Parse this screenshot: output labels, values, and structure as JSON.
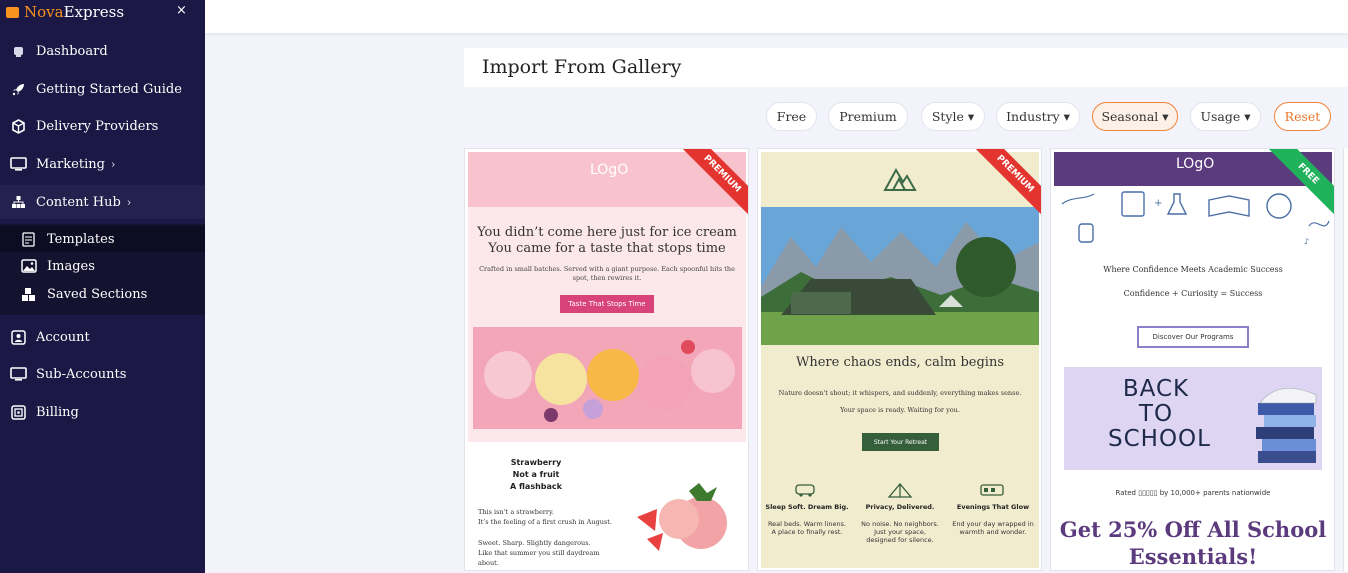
{
  "brand": {
    "part1": "Nova",
    "part2": "Express"
  },
  "sidebar": {
    "close": "×",
    "items": [
      {
        "label": "Dashboard",
        "icon": "dashboard-icon"
      },
      {
        "label": "Getting Started Guide",
        "icon": "rocket-icon"
      },
      {
        "label": "Delivery Providers",
        "icon": "box-icon"
      },
      {
        "label": "Marketing",
        "icon": "monitor-icon",
        "chevron": "›"
      },
      {
        "label": "Content Hub",
        "icon": "hierarchy-icon",
        "chevron": "›"
      }
    ],
    "sub_items": [
      {
        "label": "Templates",
        "icon": "template-icon"
      },
      {
        "label": "Images",
        "icon": "image-icon"
      },
      {
        "label": "Saved Sections",
        "icon": "blocks-icon"
      }
    ],
    "bottom_items": [
      {
        "label": "Account",
        "icon": "account-icon"
      },
      {
        "label": "Sub-Accounts",
        "icon": "monitor-icon"
      },
      {
        "label": "Billing",
        "icon": "billing-icon"
      }
    ]
  },
  "page": {
    "title": "Import From Gallery"
  },
  "filters": {
    "free": "Free",
    "premium": "Premium",
    "style": "Style ▾",
    "industry": "Industry ▾",
    "seasonal": "Seasonal ▾",
    "usage": "Usage ▾",
    "reset": "Reset"
  },
  "colors": {
    "sidebar": "#1b1845",
    "accent": "#f0833a",
    "premium": "#e3342f",
    "free": "#1fb25a"
  },
  "cards": [
    {
      "ribbon": "PREMIUM",
      "logo": "LOgO",
      "headline1": "You didn’t come here just for ice cream",
      "headline2": "You came for a taste that stops time",
      "body": "Crafted in small batches. Served with a giant purpose. Each spoonful hits the spot, then rewires it.",
      "cta": "Taste That Stops Time",
      "side_title": [
        "Strawberry",
        "Not a fruit",
        "A flashback"
      ],
      "para1": [
        "This isn’t a strawberry.",
        "It’s the feeling of a first crush in August."
      ],
      "para2": [
        "Sweet. Sharp. Slightly dangerous.",
        "Like that summer you still daydream",
        "about."
      ]
    },
    {
      "ribbon": "PREMIUM",
      "headline": "Where chaos ends, calm begins",
      "body1": "Nature doesn't shout; it whispers, and suddenly, everything makes sense.",
      "body2": "Your space is ready. Waiting for you.",
      "cta": "Start Your Retreat",
      "features": [
        {
          "title": "Sleep Soft. Dream Big.",
          "text": [
            "Real beds. Warm linens.",
            "A place to finally rest."
          ]
        },
        {
          "title": "Privacy, Delivered.",
          "text": [
            "No noise. No neighbors.",
            "Just your space,",
            "designed for silence."
          ]
        },
        {
          "title": "Evenings That Glow",
          "text": [
            "End your day wrapped in",
            "warmth and wonder."
          ]
        }
      ]
    },
    {
      "ribbon": "FREE",
      "logo": "LOgO",
      "tagline": "Where Confidence Meets Academic Success",
      "equation": "Confidence + Curiosity = Success",
      "cta": "Discover Our Programs",
      "banner": [
        "BACK",
        "TO",
        "SCHOOL"
      ],
      "rated": "Rated ▯▯▯▯▯ by 10,000+ parents nationwide",
      "offer1": "Get 25% Off All School",
      "offer2": "Essentials!"
    }
  ]
}
